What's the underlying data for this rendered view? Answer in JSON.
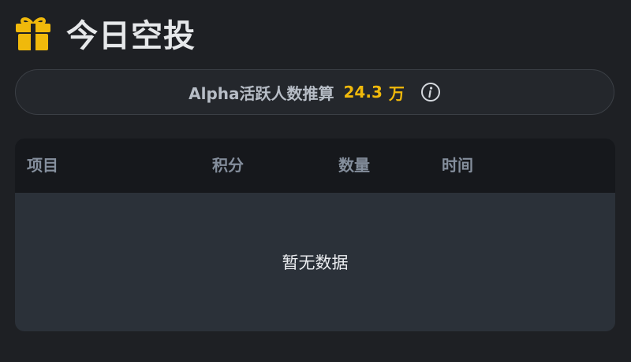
{
  "header": {
    "title": "今日空投",
    "icon": "gift-icon",
    "icon_color": "#f0b90b"
  },
  "estimate": {
    "label": "Alpha活跃人数推算",
    "value": "24.3",
    "unit": "万",
    "info_icon": "info-icon",
    "accent_color": "#f0b90b"
  },
  "table": {
    "columns": [
      "项目",
      "积分",
      "数量",
      "时间"
    ],
    "empty_text": "暂无数据"
  }
}
